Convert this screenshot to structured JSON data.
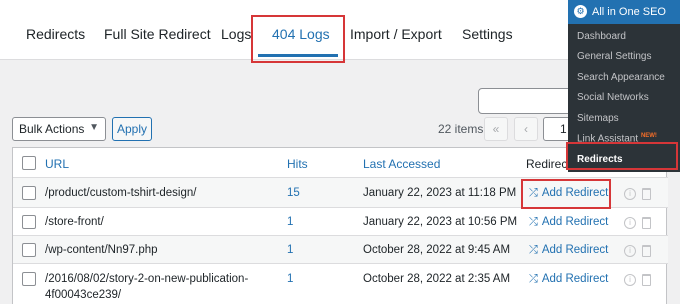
{
  "tabs": [
    {
      "label": "Redirects"
    },
    {
      "label": "Full Site Redirect"
    },
    {
      "label": "Logs"
    },
    {
      "label": "404 Logs",
      "active": true
    },
    {
      "label": "Import / Export"
    },
    {
      "label": "Settings"
    }
  ],
  "toolbar": {
    "bulk_actions": "Bulk Actions",
    "apply": "Apply",
    "items_count": "22 items",
    "first_page": "«",
    "prev_page": "‹",
    "current_page": "1"
  },
  "table": {
    "headers": {
      "url": "URL",
      "hits": "Hits",
      "last_accessed": "Last Accessed",
      "redirect": "Redirect"
    },
    "rows": [
      {
        "url": "/product/custom-tshirt-design/",
        "hits": "15",
        "last_accessed": "January 22, 2023 at 11:18 PM",
        "action": "Add Redirect"
      },
      {
        "url": "/store-front/",
        "hits": "1",
        "last_accessed": "January 22, 2023 at 10:56 PM",
        "action": "Add Redirect"
      },
      {
        "url": "/wp-content/Nn97.php",
        "hits": "1",
        "last_accessed": "October 28, 2022 at 9:45 AM",
        "action": "Add Redirect"
      },
      {
        "url_line1": "/2016/08/02/story-2-on-new-publication-",
        "url_line2": "4f00043ce239/",
        "hits": "1",
        "last_accessed": "October 28, 2022 at 2:35 AM",
        "action": "Add Redirect"
      }
    ]
  },
  "admin_menu": {
    "title": "All in One SEO",
    "items": [
      {
        "label": "Dashboard"
      },
      {
        "label": "General Settings"
      },
      {
        "label": "Search Appearance"
      },
      {
        "label": "Social Networks"
      },
      {
        "label": "Sitemaps"
      },
      {
        "label": "Link Assistant",
        "badge": "NEW!"
      },
      {
        "label": "Redirects",
        "current": true
      }
    ]
  },
  "colors": {
    "accent": "#2271b1",
    "highlight": "#d63638",
    "menu_bg": "#2c3338"
  },
  "icons": [
    "logo-icon",
    "add-redirect-icon",
    "info-icon",
    "trash-icon",
    "chevron-down-icon"
  ]
}
